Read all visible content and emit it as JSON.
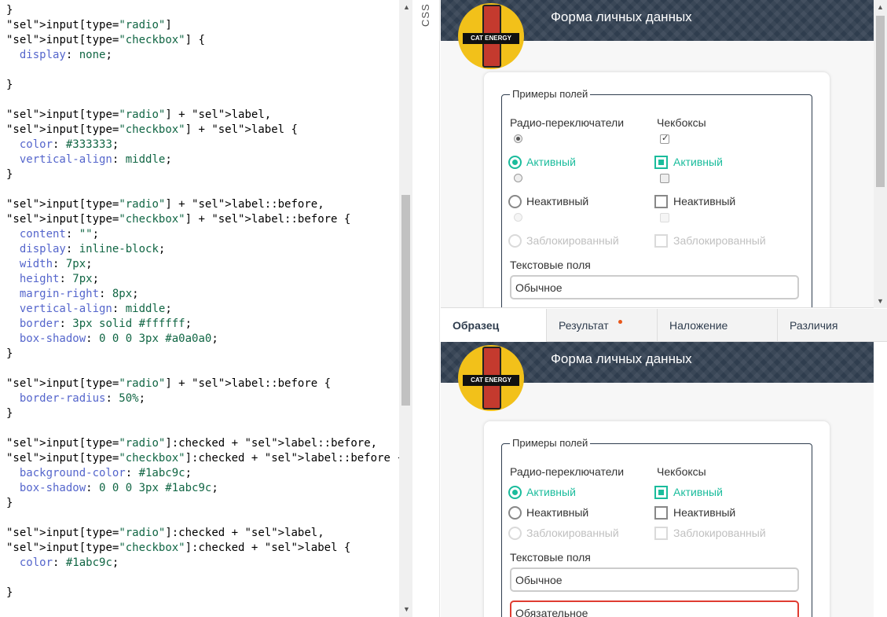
{
  "editor": {
    "lines": [
      "}",
      "input[type=\"radio\"]",
      "input[type=\"checkbox\"] {",
      "  display: none;",
      "",
      "}",
      "",
      "input[type=\"radio\"] + label,",
      "input[type=\"checkbox\"] + label {",
      "  color: #333333;",
      "  vertical-align: middle;",
      "}",
      "",
      "input[type=\"radio\"] + label::before,",
      "input[type=\"checkbox\"] + label::before {",
      "  content: \"\";",
      "  display: inline-block;",
      "  width: 7px;",
      "  height: 7px;",
      "  margin-right: 8px;",
      "  vertical-align: middle;",
      "  border: 3px solid #ffffff;",
      "  box-shadow: 0 0 0 3px #a0a0a0;",
      "}",
      "",
      "input[type=\"radio\"] + label::before {",
      "  border-radius: 50%;",
      "}",
      "",
      "input[type=\"radio\"]:checked + label::before,",
      "input[type=\"checkbox\"]:checked + label::before {",
      "  background-color: #1abc9c;",
      "  box-shadow: 0 0 0 3px #1abc9c;",
      "}",
      "",
      "input[type=\"radio\"]:checked + label,",
      "input[type=\"checkbox\"]:checked + label {",
      "  color: #1abc9c;",
      "",
      "}"
    ]
  },
  "side_label": "CSS",
  "preview": {
    "header_title": "Форма личных данных",
    "logo_text": "CAT ENERGY",
    "legend": "Примеры полей",
    "radio_heading": "Радио-переключатели",
    "checkbox_heading": "Чекбоксы",
    "active": "Активный",
    "inactive": "Неактивный",
    "disabled": "Заблокированный",
    "text_fields_heading": "Текстовые поля",
    "field_normal": "Обычное",
    "field_required": "Обязательное"
  },
  "tabs": [
    "Образец",
    "Результат",
    "Наложение",
    "Различия"
  ],
  "colors": {
    "accent": "#1abc9c",
    "header": "#2f3d4e",
    "required": "#e03c31"
  }
}
